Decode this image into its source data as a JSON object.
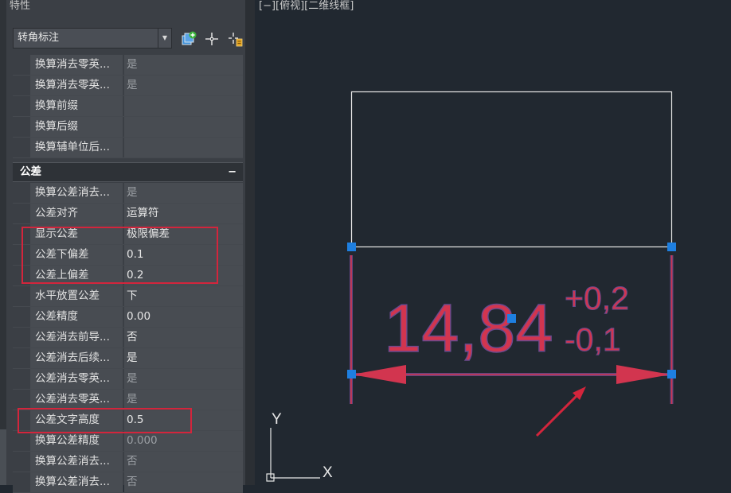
{
  "panel": {
    "title": "特性",
    "type_select": {
      "value": "转角标注"
    },
    "rows_top": [
      {
        "name": "换算消去零英...",
        "value": "是",
        "dim": true
      },
      {
        "name": "换算消去零英...",
        "value": "是",
        "dim": true
      },
      {
        "name": "换算前缀",
        "value": "",
        "dim": false
      },
      {
        "name": "换算后缀",
        "value": "",
        "dim": false
      },
      {
        "name": "换算辅单位后...",
        "value": "",
        "dim": false
      }
    ],
    "section": {
      "label": "公差",
      "collapse": "−"
    },
    "rows_tol": [
      {
        "name": "换算公差消去...",
        "value": "是",
        "dim": true
      },
      {
        "name": "公差对齐",
        "value": "运算符",
        "dim": false
      },
      {
        "name": "显示公差",
        "value": "极限偏差",
        "dim": false
      },
      {
        "name": "公差下偏差",
        "value": "0.1",
        "dim": false
      },
      {
        "name": "公差上偏差",
        "value": "0.2",
        "dim": false
      },
      {
        "name": "水平放置公差",
        "value": "下",
        "dim": false
      },
      {
        "name": "公差精度",
        "value": "0.00",
        "dim": false
      },
      {
        "name": "公差消去前导...",
        "value": "否",
        "dim": false
      },
      {
        "name": "公差消去后续...",
        "value": "是",
        "dim": false
      },
      {
        "name": "公差消去零英...",
        "value": "是",
        "dim": true
      },
      {
        "name": "公差消去零英...",
        "value": "是",
        "dim": true
      },
      {
        "name": "公差文字高度",
        "value": "0.5",
        "dim": false
      },
      {
        "name": "换算公差精度",
        "value": "0.000",
        "dim": true
      },
      {
        "name": "换算公差消去...",
        "value": "否",
        "dim": true
      },
      {
        "name": "换算公差消去...",
        "value": "否",
        "dim": true
      }
    ]
  },
  "viewport": {
    "label": "[−][俯视][二维线框]",
    "dimension": {
      "text": "14,84",
      "tol_upper": "+0,2",
      "tol_lower": "-0,1"
    },
    "ucs": {
      "y_label": "Y",
      "x_label": "X"
    }
  },
  "colors": {
    "dimension": "#d2354f",
    "grip": "#1e7fe0",
    "highlight": "#d3253c"
  }
}
